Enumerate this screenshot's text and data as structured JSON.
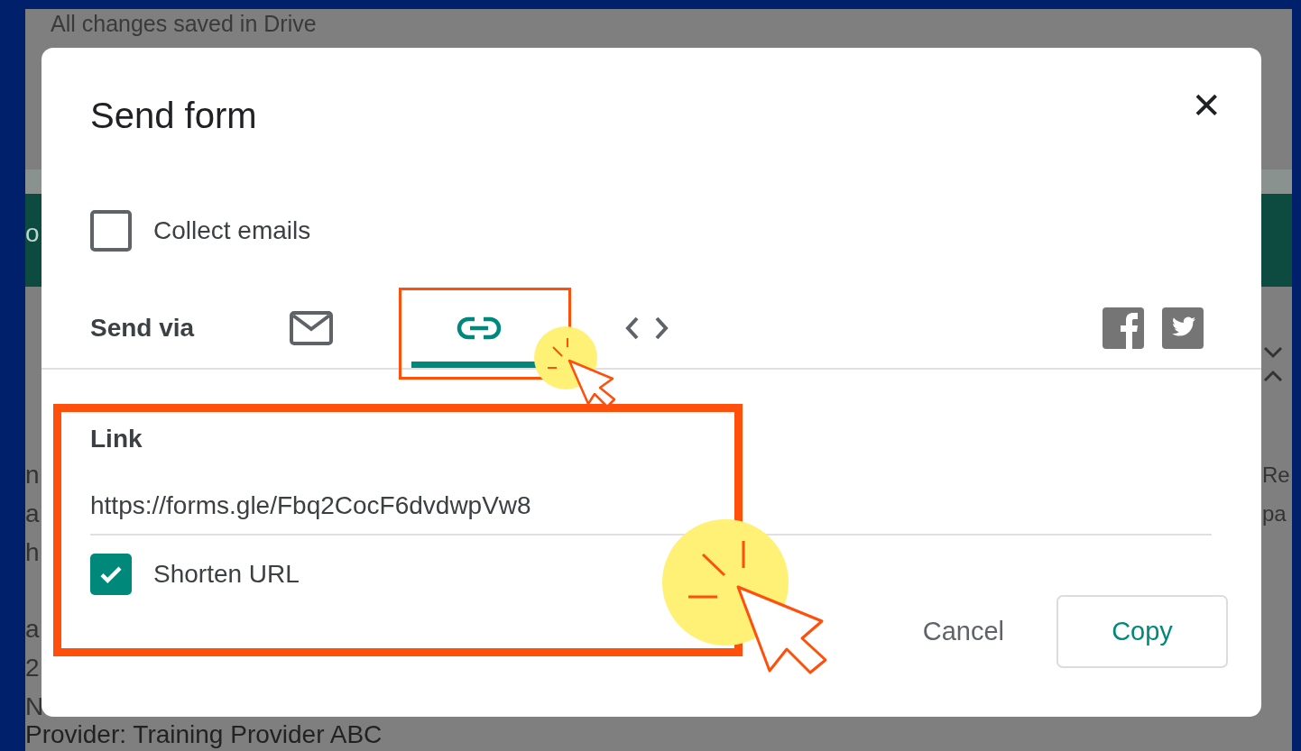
{
  "background": {
    "status": "All changes saved in Drive",
    "band_text": "o",
    "left_lines_a": [
      "n",
      "a",
      "h"
    ],
    "left_lines_b": [
      "a",
      "2",
      "N"
    ],
    "right_lines": [
      "Re",
      "pa"
    ],
    "bottom_line": "Provider: Training Provider ABC"
  },
  "dialog": {
    "title": "Send form",
    "close": "✕",
    "collect_emails": {
      "label": "Collect emails",
      "checked": false
    },
    "send_via": {
      "label": "Send via",
      "tabs": [
        {
          "kind": "email",
          "selected": false
        },
        {
          "kind": "link",
          "selected": true
        },
        {
          "kind": "embed",
          "selected": false
        }
      ],
      "social": [
        {
          "kind": "facebook"
        },
        {
          "kind": "twitter"
        }
      ]
    },
    "link": {
      "heading": "Link",
      "url": "https://forms.gle/Fbq2CocF6dvdwpVw8",
      "shorten_url": {
        "label": "Shorten URL",
        "checked": true
      }
    },
    "buttons": [
      {
        "label": "Cancel",
        "kind": "text"
      },
      {
        "label": "Copy",
        "kind": "outlined"
      }
    ]
  }
}
